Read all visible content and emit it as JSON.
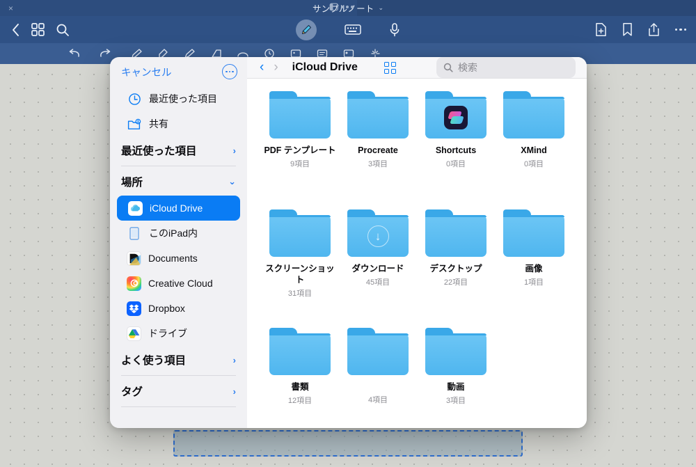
{
  "window": {
    "close_label": "×",
    "doc_title": "サンプルノート",
    "doc_title_chevron": "⌄",
    "multitask_icon": "split-view-icon"
  },
  "navbar": {
    "back_icon": "chevron-left-icon",
    "grid_icon": "grid-view-icon",
    "search_icon": "search-icon",
    "pen_icon": "pen-tool-icon",
    "keyboard_icon": "keyboard-icon",
    "mic_icon": "microphone-icon",
    "add_page_icon": "add-page-icon",
    "bookmark_icon": "bookmark-icon",
    "share_icon": "share-icon",
    "more_icon": "more-icon"
  },
  "toolstrip": {
    "undo_icon": "undo-icon",
    "redo_icon": "redo-icon",
    "tools": [
      "pen-icon",
      "marker-icon",
      "pencil-icon",
      "eraser-icon",
      "lasso-icon",
      "shape-icon",
      "image-icon",
      "text-icon",
      "sticker-icon",
      "sparkle-icon"
    ],
    "camera_icon": "camera-icon",
    "thumbnail_count": 10
  },
  "files_dialog": {
    "sidebar": {
      "cancel_label": "キャンセル",
      "more_icon": "more-circle-icon",
      "quick_rows": [
        {
          "label": "最近使った項目",
          "icon": "clock-icon"
        },
        {
          "label": "共有",
          "icon": "shared-folder-icon"
        }
      ],
      "section_recents": {
        "label": "最近使った項目",
        "chevron": "›"
      },
      "section_locations": {
        "label": "場所",
        "chevron": "⌄"
      },
      "locations": [
        {
          "label": "iCloud Drive",
          "icon": "icloud-icon",
          "selected": true
        },
        {
          "label": "このiPad内",
          "icon": "ipad-icon",
          "selected": false
        },
        {
          "label": "Documents",
          "icon": "documents-app-icon",
          "selected": false
        },
        {
          "label": "Creative Cloud",
          "icon": "creative-cloud-icon",
          "selected": false
        },
        {
          "label": "Dropbox",
          "icon": "dropbox-icon",
          "selected": false
        },
        {
          "label": "ドライブ",
          "icon": "google-drive-icon",
          "selected": false
        }
      ],
      "section_favorites": {
        "label": "よく使う項目",
        "chevron": "›"
      },
      "section_tags": {
        "label": "タグ",
        "chevron": "›"
      }
    },
    "header": {
      "back_chevron": "‹",
      "forward_chevron": "›",
      "path_title": "iCloud Drive",
      "view_toggle_icon": "grid-view-icon",
      "search_icon": "search-icon",
      "search_placeholder": "検索",
      "search_value": ""
    },
    "items": [
      {
        "name": "PDF テンプレート",
        "count": "9項目",
        "badge": "none"
      },
      {
        "name": "Procreate",
        "count": "3項目",
        "badge": "none"
      },
      {
        "name": "Shortcuts",
        "count": "0項目",
        "badge": "shortcuts"
      },
      {
        "name": "XMind",
        "count": "0項目",
        "badge": "none"
      },
      {
        "name": "スクリーンショット",
        "count": "31項目",
        "badge": "none"
      },
      {
        "name": "ダウンロード",
        "count": "45項目",
        "badge": "download"
      },
      {
        "name": "デスクトップ",
        "count": "22項目",
        "badge": "none"
      },
      {
        "name": "画像",
        "count": "1項目",
        "badge": "none"
      },
      {
        "name": "書類",
        "count": "12項目",
        "badge": "none"
      },
      {
        "name": "",
        "count": "4項目",
        "badge": "none"
      },
      {
        "name": "動画",
        "count": "3項目",
        "badge": "none"
      }
    ]
  },
  "colors": {
    "accent_blue": "#0a7cf4",
    "navbar_blue": "#2f5185",
    "window_blue": "#2d4d7e",
    "folder_blue": "#4fb6ef",
    "sidebar_bg": "#f1f1f4"
  }
}
